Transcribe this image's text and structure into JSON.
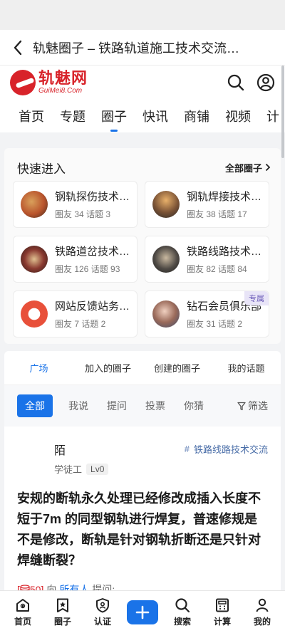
{
  "browser": {
    "title": "轨魅圈子 – 铁路轨道施工技术交流…"
  },
  "header": {
    "logo_cn": "轨魅网",
    "logo_en": "GuiMei8.Com",
    "search_icon": "search-icon",
    "user_icon": "user-icon"
  },
  "nav": {
    "items": [
      "首页",
      "专题",
      "圈子",
      "快讯",
      "商铺",
      "视频",
      "计"
    ],
    "active": "圈子"
  },
  "quick": {
    "title": "快速进入",
    "all_label": "全部圈子",
    "circles": [
      {
        "name": "钢轨探伤技术交流",
        "meta": "圈友 34 话题 3",
        "color": "#b9542c"
      },
      {
        "name": "钢轨焊接技术交流",
        "meta": "圈友 38 话题 17",
        "color": "#7a5235"
      },
      {
        "name": "铁路道岔技术交流",
        "meta": "圈友 126 话题 93",
        "color": "#8a3a30"
      },
      {
        "name": "铁路线路技术交流",
        "meta": "圈友 82 话题 84",
        "color": "#4f4a45"
      },
      {
        "name": "网站反馈站务处理",
        "meta": "圈友 7 话题 2",
        "color": "#e8503a"
      },
      {
        "name": "钻石会员俱乐部",
        "meta": "圈友 31 话题 2",
        "color": "#9a6a5a",
        "badge": "专属"
      }
    ]
  },
  "tabs": {
    "items": [
      "广场",
      "加入的圈子",
      "创建的圈子",
      "我的话题"
    ],
    "active": "广场"
  },
  "filters": {
    "items": [
      "全部",
      "我说",
      "提问",
      "投票",
      "你猜"
    ],
    "active": "全部",
    "filter_label": "筛选"
  },
  "post": {
    "author": "陌",
    "role": "学徒工",
    "level": "Lv0",
    "tag": "铁路线路技术交流",
    "text": "安规的断轨永久处理已经修改成插入长度不短于7m 的同型钢轨进行焊复，普速修规是不是修改，断轨是针对钢轨折断还是只针对焊缝断裂？",
    "bounty_open": "[",
    "bounty_value": "50",
    "bounty_close": "]",
    "to": "向",
    "to_all": "所有人",
    "ask": "提问:"
  },
  "bottom": {
    "items": [
      {
        "label": "首页",
        "icon": "home-icon"
      },
      {
        "label": "圈子",
        "icon": "bookmark-star-icon"
      },
      {
        "label": "认证",
        "icon": "shield-icon"
      },
      {
        "label": "",
        "icon": "plus-icon"
      },
      {
        "label": "搜索",
        "icon": "search-icon"
      },
      {
        "label": "计算",
        "icon": "calculator-icon"
      },
      {
        "label": "我的",
        "icon": "user-icon"
      }
    ]
  },
  "colors": {
    "accent": "#1a73e8",
    "brand": "#d8232a"
  }
}
